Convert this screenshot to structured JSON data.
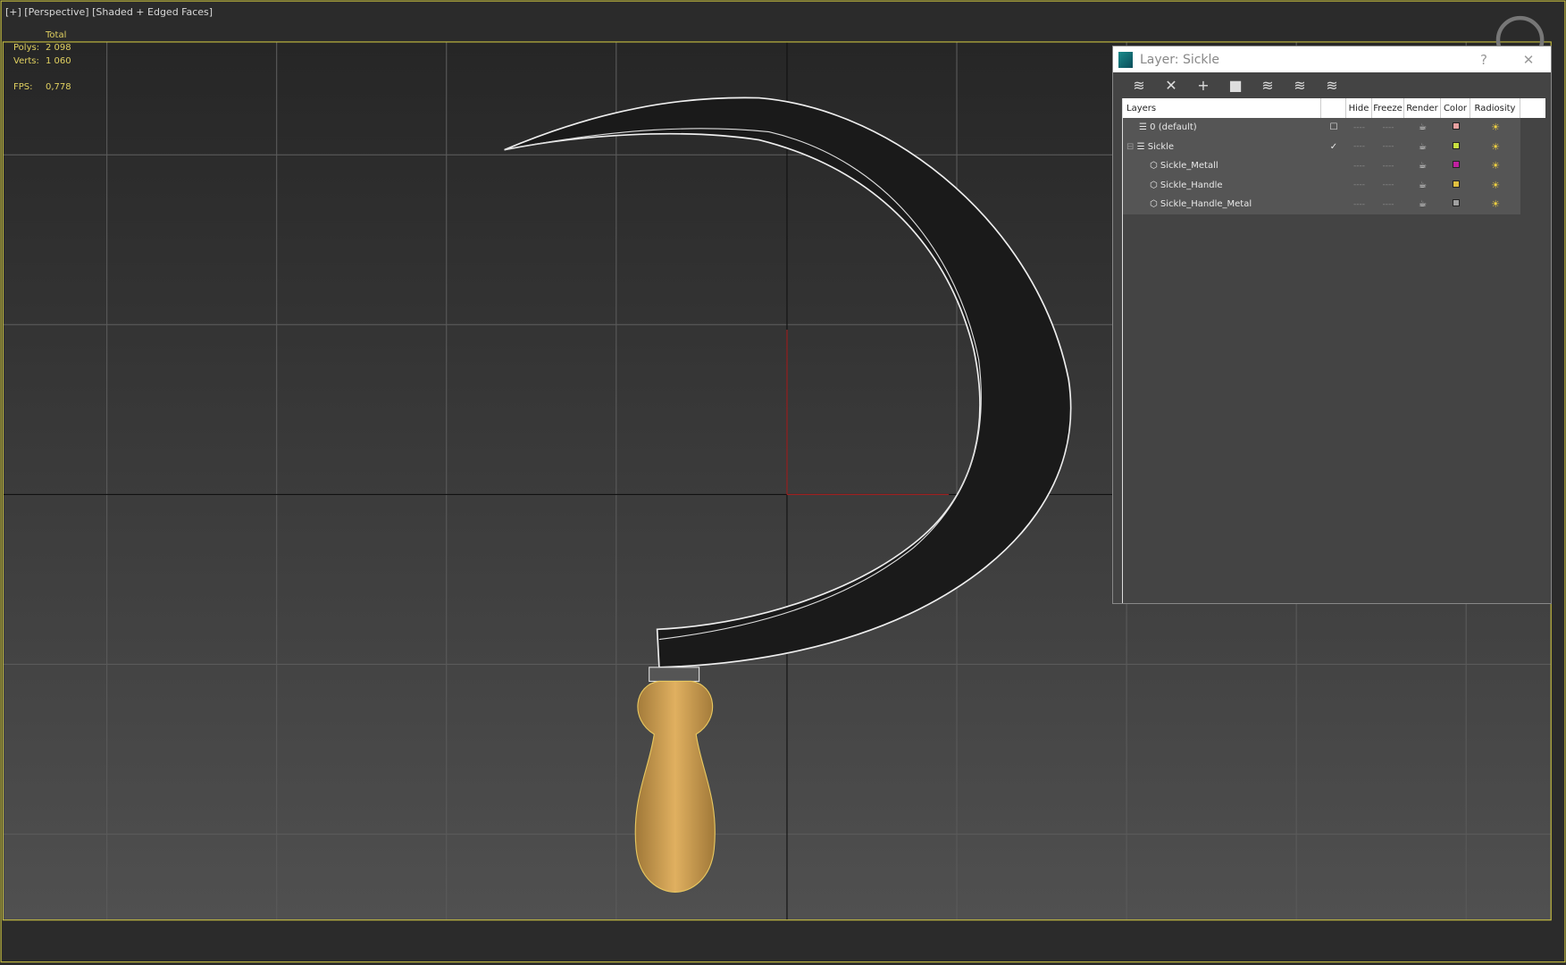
{
  "viewport": {
    "label": "[+] [Perspective] [Shaded + Edged Faces]",
    "stats": {
      "header": "Total",
      "polys_label": "Polys:",
      "polys": "2 098",
      "verts_label": "Verts:",
      "verts": "1 060",
      "fps_label": "FPS:",
      "fps": "0,778"
    }
  },
  "panel": {
    "title": "Layer: Sickle",
    "help": "?",
    "close": "✕",
    "toolbar": [
      {
        "icon": "new-layer-icon",
        "glyph": "≋"
      },
      {
        "icon": "delete-icon",
        "glyph": "✕"
      },
      {
        "icon": "add-icon",
        "glyph": "+"
      },
      {
        "icon": "select-objects-icon",
        "glyph": "■"
      },
      {
        "icon": "select-layer-icon",
        "glyph": "≋"
      },
      {
        "icon": "highlight-layer-icon",
        "glyph": "≋"
      },
      {
        "icon": "hide-freeze-icon",
        "glyph": "≋"
      }
    ],
    "columns": [
      "Layers",
      "",
      "Hide",
      "Freeze",
      "Render",
      "Color",
      "Radiosity"
    ],
    "rows": [
      {
        "name": "0 (default)",
        "active": "☐",
        "hide": "----",
        "freeze": "----",
        "color": "#e8a0a0",
        "level": 0
      },
      {
        "name": "Sickle",
        "active": "✓",
        "hide": "----",
        "freeze": "----",
        "color": "#c8e040",
        "level": 0
      },
      {
        "name": "Sickle_Metall",
        "active": "",
        "hide": "----",
        "freeze": "----",
        "color": "#c020a0",
        "level": 1
      },
      {
        "name": "Sickle_Handle",
        "active": "",
        "hide": "----",
        "freeze": "----",
        "color": "#e0c040",
        "level": 1
      },
      {
        "name": "Sickle_Handle_Metal",
        "active": "",
        "hide": "----",
        "freeze": "----",
        "color": "#a0a0a0",
        "level": 1
      }
    ]
  }
}
